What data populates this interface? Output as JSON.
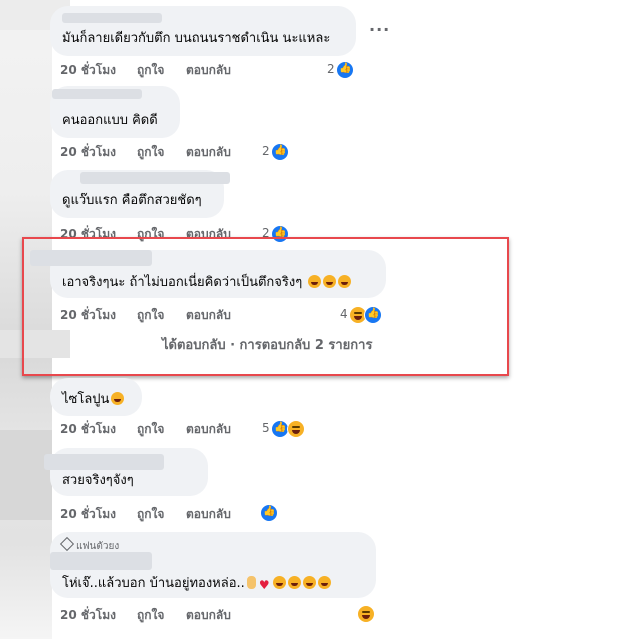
{
  "comments": [
    {
      "text": "มันก็ลายเดียวกับตึก บนถนนราชดำเนิน นะแหละ",
      "time": "20 ชั่วโมง",
      "like": "ถูกใจ",
      "reply": "ตอบกลับ",
      "reactions_count": "2",
      "reactions": [
        "like-icon"
      ]
    },
    {
      "text": "คนออกแบบ คิดดี",
      "time": "20 ชั่วโมง",
      "like": "ถูกใจ",
      "reply": "ตอบกลับ",
      "reactions_count": "2",
      "reactions": [
        "like-icon"
      ]
    },
    {
      "text": "ดูแว๊บแรก คือตึกสวยชัดๆ",
      "time": "20 ชั่วโมง",
      "like": "ถูกใจ",
      "reply": "ตอบกลับ",
      "reactions_count": "2",
      "reactions": [
        "like-icon"
      ]
    },
    {
      "text": "เอาจริงๆนะ ถ้าไม่บอกเนี่ยคิดว่าเป็นตึกจริงๆ",
      "time": "20 ชั่วโมง",
      "like": "ถูกใจ",
      "reply": "ตอบกลับ",
      "reactions_count": "4",
      "reactions": [
        "haha-icon",
        "like-icon"
      ],
      "replies_text": "ได้ตอบกลับ · การตอบกลับ 2 รายการ"
    },
    {
      "text": "ไซโลปูน",
      "time": "20 ชั่วโมง",
      "like": "ถูกใจ",
      "reply": "ตอบกลับ",
      "reactions_count": "5",
      "reactions": [
        "like-icon",
        "haha-icon"
      ]
    },
    {
      "text": "สวยจริงๆจังๆ",
      "time": "20 ชั่วโมง",
      "like": "ถูกใจ",
      "reply": "ตอบกลับ",
      "reactions_count": "",
      "reactions": [
        "like-icon"
      ]
    },
    {
      "text": "โห่เจ๊..แล้วบอก บ้านอยู่ทองหล่อ..",
      "time": "20 ชั่วโมง",
      "like": "ถูกใจ",
      "reply": "ตอบกลับ",
      "reactions_count": "",
      "reactions": [
        "haha-icon"
      ],
      "badge": "แฟนตัวยง"
    }
  ],
  "colors": {
    "bubble": "#f0f2f5",
    "meta_text": "#65676b",
    "like_blue": "#1877f2",
    "highlight": "#e8484d"
  }
}
